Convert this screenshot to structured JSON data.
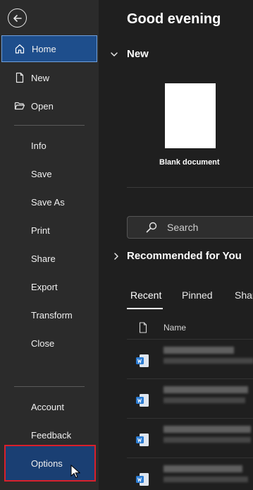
{
  "sidebar": {
    "items_top": [
      {
        "label": "Home",
        "icon": "home-icon"
      },
      {
        "label": "New",
        "icon": "new-doc-icon"
      },
      {
        "label": "Open",
        "icon": "folder-open-icon"
      }
    ],
    "items_mid": [
      "Info",
      "Save",
      "Save As",
      "Print",
      "Share",
      "Export",
      "Transform",
      "Close"
    ],
    "items_bottom": [
      "Account",
      "Feedback",
      "Options"
    ]
  },
  "main": {
    "greeting": "Good evening",
    "new_section": "New",
    "blank_document_label": "Blank document",
    "search": {
      "placeholder": "Search"
    },
    "recommended_section": "Recommended for You",
    "tabs": [
      "Recent",
      "Pinned",
      "Shared with Me"
    ],
    "file_list": {
      "column_name": "Name"
    }
  },
  "colors": {
    "accent": "#1e4e8c",
    "highlight_border": "#d9202b",
    "sidebar_bg": "#2b2b2b",
    "main_bg": "#1f1f1f",
    "word_blue": "#2b7cd3"
  }
}
